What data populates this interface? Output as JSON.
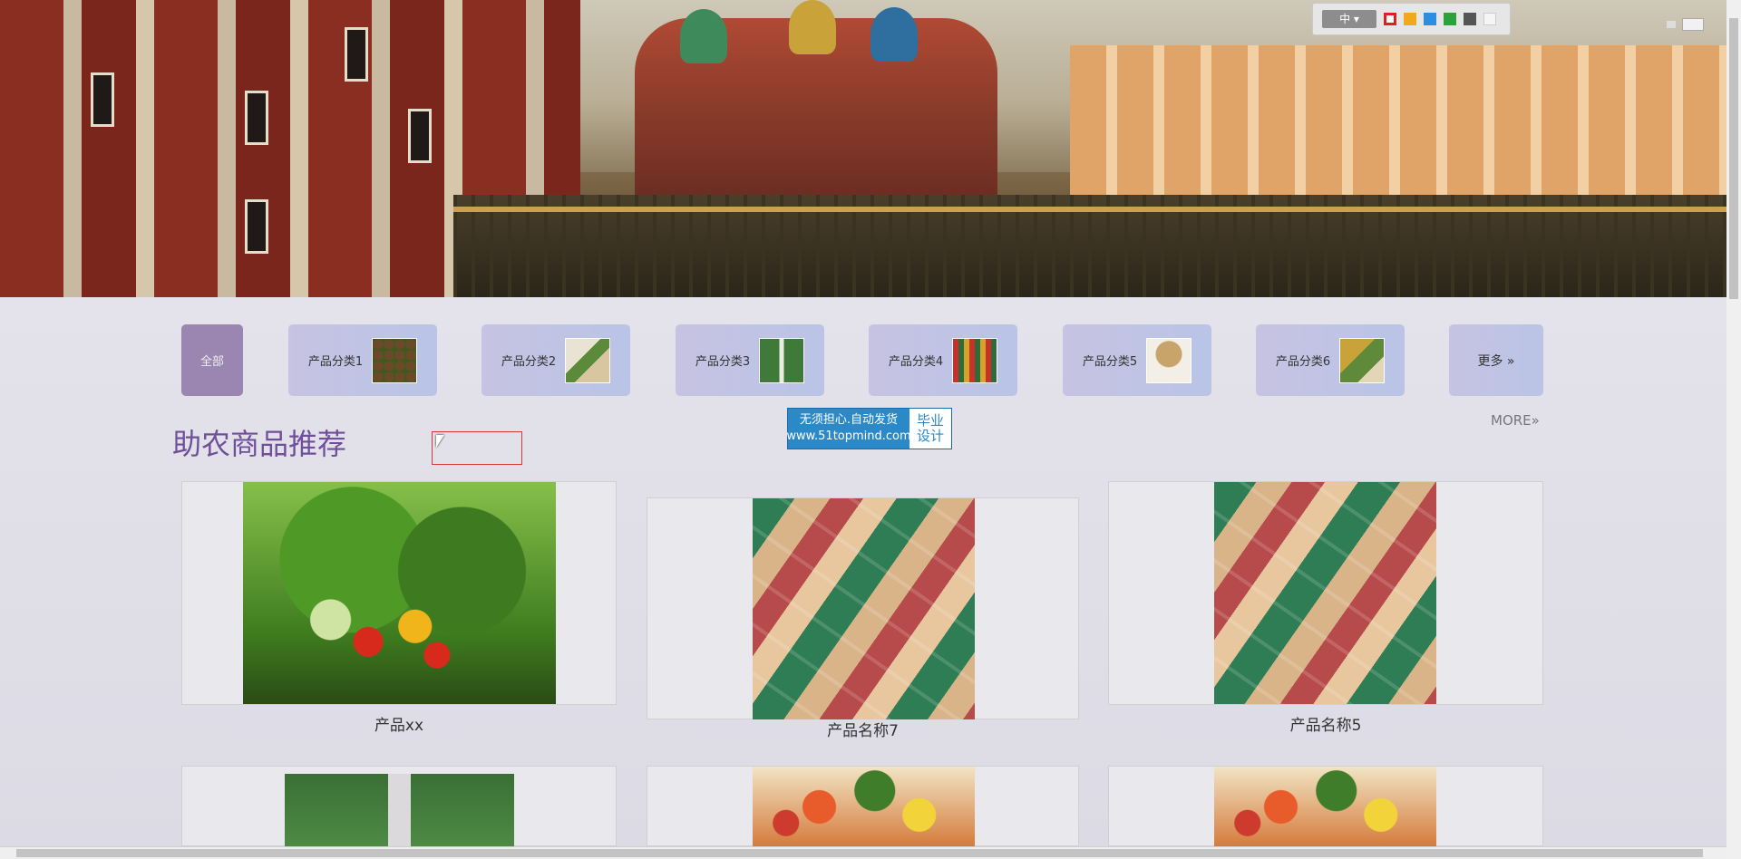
{
  "toolbar": {
    "lang_label": "中 ▾",
    "swatches": [
      "#e02020",
      "#f2a81c",
      "#2d8ee0",
      "#2ba23a",
      "#555555",
      "#f5f5f5"
    ]
  },
  "categories": [
    {
      "label": "全部"
    },
    {
      "label": "产品分类1"
    },
    {
      "label": "产品分类2"
    },
    {
      "label": "产品分类3"
    },
    {
      "label": "产品分类4"
    },
    {
      "label": "产品分类5"
    },
    {
      "label": "产品分类6"
    },
    {
      "label": "更多 »"
    }
  ],
  "section": {
    "title": "助农商品推荐",
    "more_label": "MORE»"
  },
  "ad": {
    "line1": "无须担心.自动发货",
    "line2": "www.51topmind.com",
    "badge1": "毕业",
    "badge2": "设计"
  },
  "products": [
    {
      "name": "产品xx"
    },
    {
      "name": "产品名称7"
    },
    {
      "name": "产品名称5"
    }
  ],
  "colors": {
    "accent": "#6f4f9a",
    "category_bg": "#c7c3e2",
    "category_active": "#9a86b0"
  }
}
